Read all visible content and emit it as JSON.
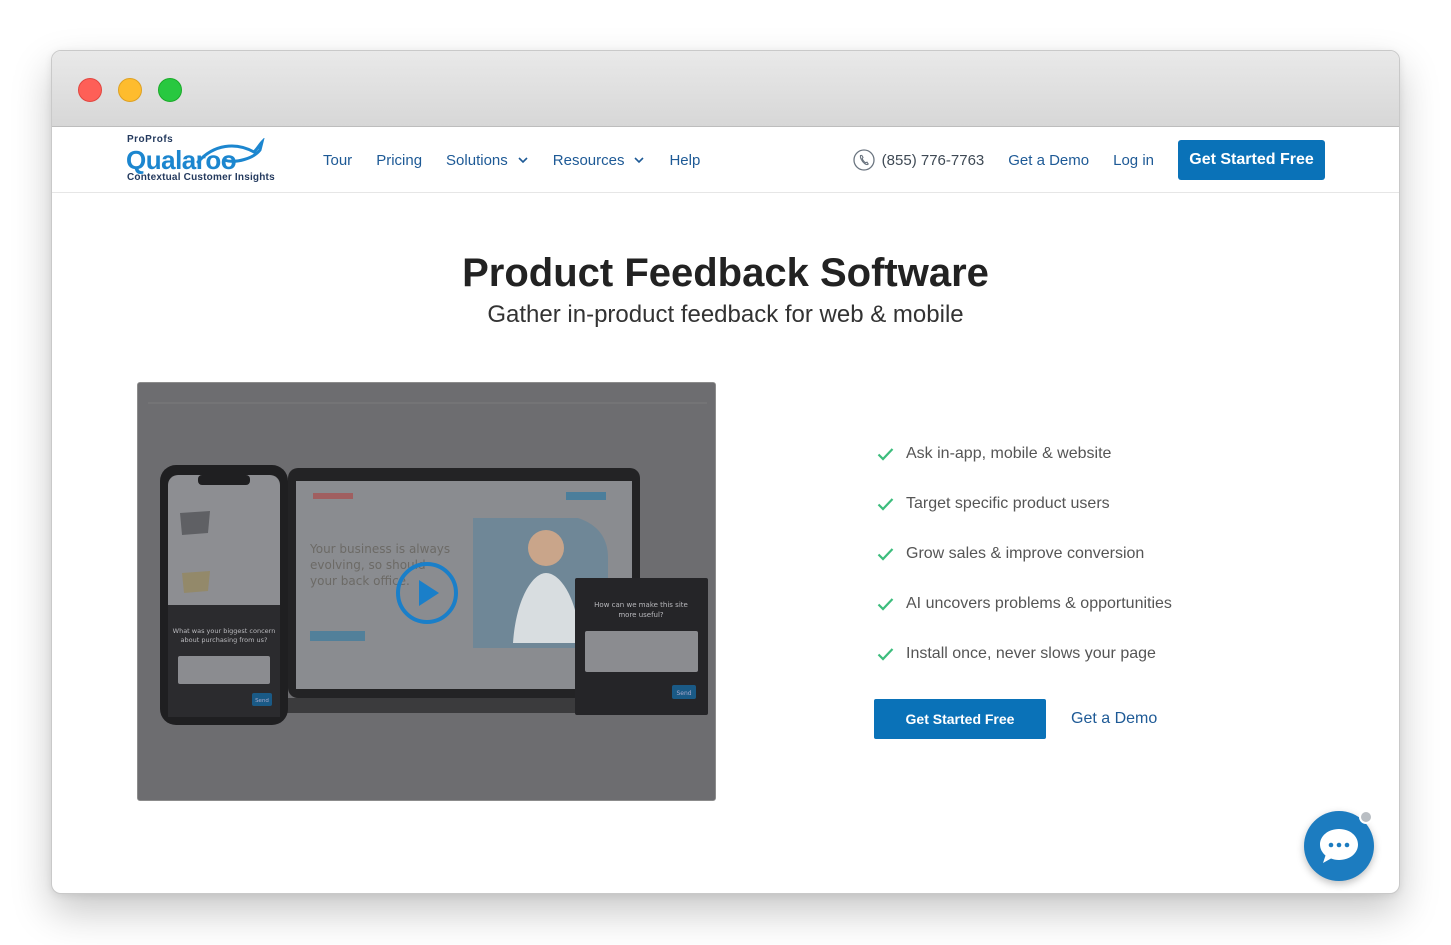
{
  "brand": {
    "top_label": "ProProfs",
    "name": "Qualaroo",
    "tagline": "Contextual Customer Insights",
    "color": "#1c86cf"
  },
  "nav": {
    "items": [
      {
        "label": "Tour",
        "has_dropdown": false
      },
      {
        "label": "Pricing",
        "has_dropdown": false
      },
      {
        "label": "Solutions",
        "has_dropdown": true
      },
      {
        "label": "Resources",
        "has_dropdown": true
      },
      {
        "label": "Help",
        "has_dropdown": false
      }
    ],
    "phone": "(855) 776-7763",
    "demo_label": "Get a Demo",
    "login_label": "Log in",
    "cta_label": "Get Started Free"
  },
  "hero": {
    "title": "Product Feedback Software",
    "subtitle": "Gather in-product feedback for web & mobile"
  },
  "video": {
    "phone_survey_question": "What was your biggest concern about purchasing from us?",
    "phone_send_label": "Send",
    "laptop_headline": "Your business is always evolving, so should your back office.",
    "laptop_survey_question": "How can we make this site more useful?",
    "laptop_send_label": "Send"
  },
  "features": [
    "Ask in-app, mobile & website",
    "Target specific product users",
    "Grow sales & improve conversion",
    "AI uncovers problems & opportunities",
    "Install once, never slows your page"
  ],
  "cta": {
    "primary_label": "Get Started Free",
    "secondary_label": "Get a Demo"
  },
  "colors": {
    "accent": "#0a72b8",
    "link": "#1e5a96",
    "check": "#3dbd7d"
  }
}
